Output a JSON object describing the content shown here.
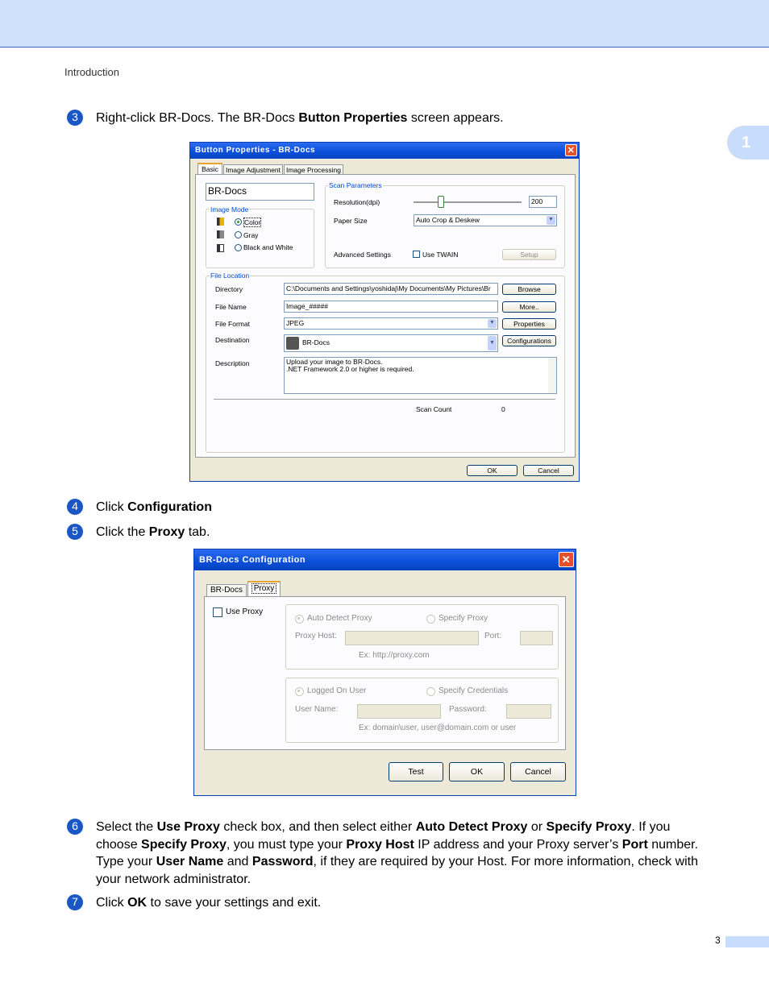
{
  "header": {
    "section": "Introduction",
    "chapter": "1"
  },
  "steps": [
    {
      "num": "3",
      "html": "Right-click BR-Docs. The BR-Docs <b>Button Properties</b> screen appears."
    },
    {
      "num": "4",
      "html": "Click <b>Configuration</b>"
    },
    {
      "num": "5",
      "html": "Click the <b>Proxy</b> tab."
    },
    {
      "num": "6",
      "html": "Select the <b>Use Proxy</b> check box, and then select either <b>Auto Detect Proxy</b> or <b>Specify Proxy</b>. If you choose <b>Specify Proxy</b>, you must type your <b>Proxy Host</b> IP address and your Proxy server’s <b>Port</b> number. Type your <b>User Name</b> and <b>Password</b>, if they are required by your Host. For more information, check with your network administrator."
    },
    {
      "num": "7",
      "html": "Click <b>OK</b> to save your settings and exit."
    }
  ],
  "dialog1": {
    "title": "Button Properties - BR-Docs",
    "tabs": [
      "Basic",
      "Image Adjustment",
      "Image Processing"
    ],
    "name_field": "BR-Docs",
    "image_mode": {
      "label": "Image Mode",
      "options": [
        "Color",
        "Gray",
        "Black and White"
      ]
    },
    "scan_params": {
      "label": "Scan Parameters",
      "resolution_label": "Resolution(dpi)",
      "resolution_value": "200",
      "paper_size_label": "Paper Size",
      "paper_size_value": "Auto Crop & Deskew",
      "advanced_label": "Advanced Settings",
      "use_twain": "Use TWAIN",
      "setup": "Setup"
    },
    "file_location": {
      "label": "File Location",
      "directory_label": "Directory",
      "directory_value": "C:\\Documents and Settings\\yoshidaj\\My Documents\\My Pictures\\Br",
      "browse": "Browse",
      "file_name_label": "File Name",
      "file_name_value": "Image_#####",
      "more": "More..",
      "file_format_label": "File Format",
      "file_format_value": "JPEG",
      "properties": "Properties",
      "destination_label": "Destination",
      "destination_value": "BR-Docs",
      "configurations": "Configurations",
      "description_label": "Description",
      "description_line1": "Upload your image to BR-Docs.",
      "description_line2": ".NET Framework 2.0 or higher is required.",
      "scan_count_label": "Scan Count",
      "scan_count_value": "0"
    },
    "ok": "OK",
    "cancel": "Cancel"
  },
  "dialog2": {
    "title": "BR-Docs Configuration",
    "tabs": [
      "BR-Docs",
      "Proxy"
    ],
    "use_proxy": "Use Proxy",
    "auto_detect": "Auto Detect Proxy",
    "specify_proxy": "Specify Proxy",
    "proxy_host": "Proxy Host:",
    "port": "Port:",
    "proxy_example": "Ex: http://proxy.com",
    "logged_on_user": "Logged On User",
    "specify_credentials": "Specify Credentials",
    "user_name": "User Name:",
    "password": "Password:",
    "user_example": "Ex: domain\\user, user@domain.com or user",
    "test": "Test",
    "ok": "OK",
    "cancel": "Cancel"
  },
  "footer": {
    "page": "3"
  }
}
